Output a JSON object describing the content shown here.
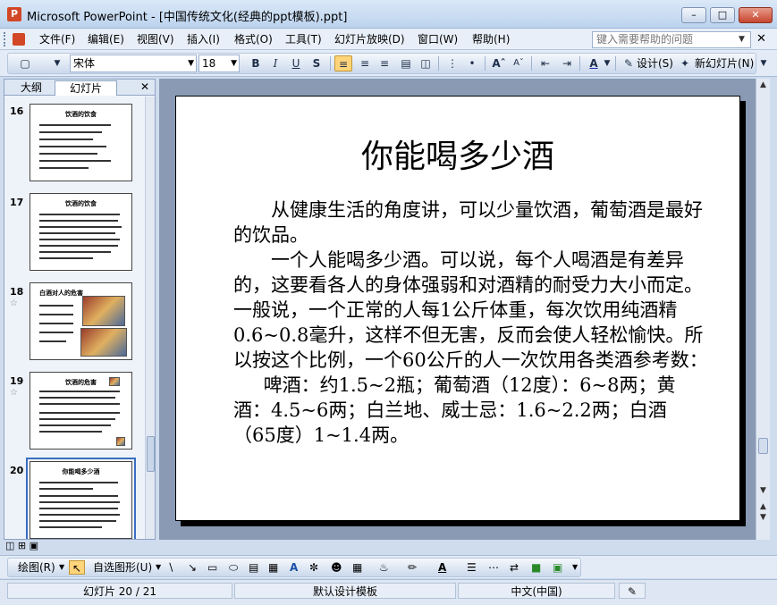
{
  "window": {
    "title": "Microsoft PowerPoint - [中国传统文化(经典的ppt模板).ppt]"
  },
  "menu": {
    "items": [
      "文件(F)",
      "编辑(E)",
      "视图(V)",
      "插入(I)",
      "格式(O)",
      "工具(T)",
      "幻灯片放映(D)",
      "窗口(W)",
      "帮助(H)"
    ],
    "help_placeholder": "键入需要帮助的问题"
  },
  "toolbar": {
    "font_name": "宋体",
    "font_size": "18",
    "bold": "B",
    "italic": "I",
    "underline": "U",
    "shadow": "S",
    "design_label": "设计(S)",
    "new_slide_label": "新幻灯片(N)"
  },
  "left_pane": {
    "tab_outline": "大纲",
    "tab_slides": "幻灯片",
    "thumbnails": [
      {
        "num": "16",
        "title": "饮酒的饮食",
        "star": false
      },
      {
        "num": "17",
        "title": "饮酒的饮食",
        "star": false
      },
      {
        "num": "18",
        "title": "白酒对人的危害",
        "star": true
      },
      {
        "num": "19",
        "title": "饮酒的危害",
        "star": true
      },
      {
        "num": "20",
        "title": "你能喝多少酒",
        "star": false,
        "selected": true
      }
    ]
  },
  "slide": {
    "title": "你能喝多少酒",
    "paragraphs": [
      "从健康生活的角度讲，可以少量饮酒，葡萄酒是最好的饮品。",
      "一个人能喝多少酒。可以说，每个人喝酒是有差异的，这要看各人的身体强弱和对酒精的耐受力大小而定。一般说，一个正常的人每1公斤体重，每次饮用纯酒精0.6~0.8毫升，这样不但无害，反而会使人轻松愉快。所以按这个比例，一个60公斤的人一次饮用各类酒参考数：",
      "啤酒：约1.5~2瓶；葡萄酒（12度）：6~8两；黄酒：4.5~6两；白兰地、威士忌：1.6~2.2两；白酒（65度）1~1.4两。"
    ]
  },
  "drawbar": {
    "draw_label": "绘图(R)",
    "autoshapes_label": "自选图形(U)"
  },
  "status": {
    "slide_pos": "幻灯片 20 / 21",
    "template": "默认设计模板",
    "language": "中文(中国)"
  }
}
